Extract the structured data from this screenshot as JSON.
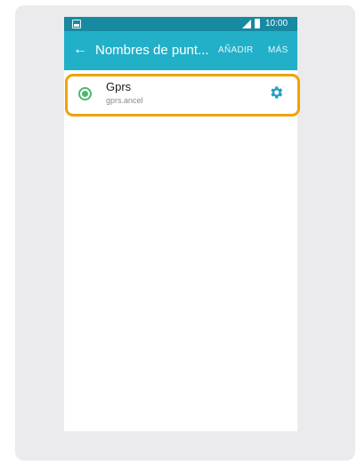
{
  "status_bar": {
    "time": "10:00",
    "icons": [
      "image-icon",
      "signal-icon",
      "battery-icon"
    ]
  },
  "app_bar": {
    "title": "Nombres de punt...",
    "back_icon": "arrow-left-icon",
    "actions": {
      "add": "AÑADIR",
      "more": "MÁS"
    }
  },
  "apn_list": {
    "items": [
      {
        "name": "Gprs",
        "apn": "gprs.ancel",
        "selected": true,
        "settings_icon": "gear-icon"
      }
    ]
  },
  "colors": {
    "status_bar": "#1789a0",
    "app_bar": "#22b0c8",
    "radio_selected": "#4bb86e",
    "gear": "#1f9fc4",
    "highlight": "#f0a300",
    "frame": "#ebebed"
  }
}
